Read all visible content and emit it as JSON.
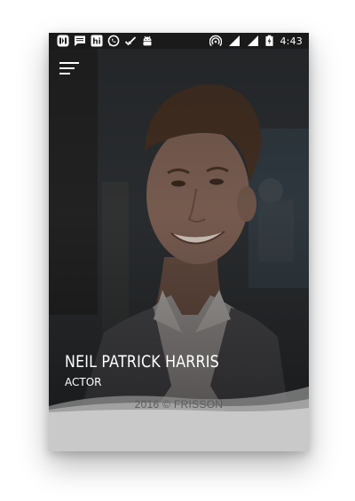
{
  "status_bar": {
    "time": "4:43",
    "left_icons": [
      "app-notification-icon",
      "message-icon",
      "hike-icon",
      "whatsapp-icon",
      "checkmark-icon",
      "android-icon"
    ],
    "right_icons": [
      "hotspot-icon",
      "cell-signal-icon",
      "wifi-signal-icon",
      "battery-charging-icon"
    ]
  },
  "header": {
    "menu_icon": "hamburger-menu-icon"
  },
  "profile": {
    "name": "NEIL PATRICK HARRIS",
    "role": "ACTOR"
  },
  "footer": {
    "text": "2016 © FRISSON"
  },
  "colors": {
    "status_bar_bg": "#1a1a1a",
    "footer_bg": "#c9c9c9",
    "footer_text": "#5c5c5c",
    "name_text": "#ffffff"
  }
}
